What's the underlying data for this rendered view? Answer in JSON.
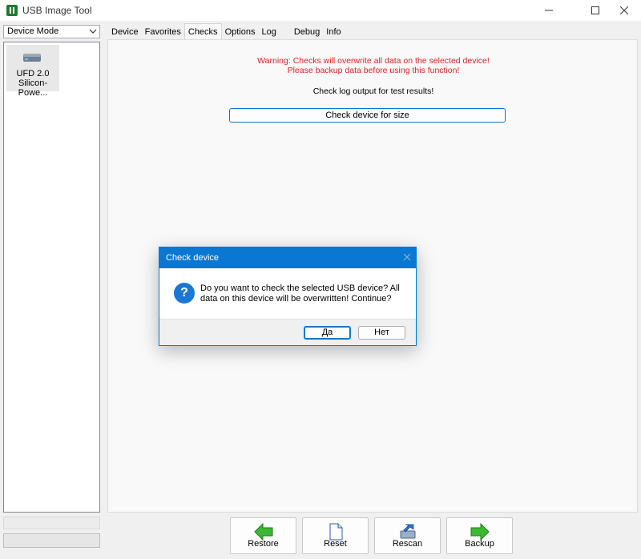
{
  "window": {
    "title": "USB Image Tool"
  },
  "sidebar": {
    "mode_selected": "Device Mode",
    "devices": [
      {
        "line1": "UFD 2.0",
        "line2": "Silicon-Powe..."
      }
    ]
  },
  "tabs": [
    {
      "label": "Device"
    },
    {
      "label": "Favorites"
    },
    {
      "label": "Checks"
    },
    {
      "label": "Options"
    },
    {
      "label": "Log"
    },
    {
      "label": "Debug"
    },
    {
      "label": "Info"
    }
  ],
  "checks": {
    "warning_line1": "Warning: Checks will overwrite all data on the selected device!",
    "warning_line2": "Please backup data before using this function!",
    "info": "Check log output for test results!",
    "check_size_button": "Check device for size"
  },
  "toolbar": {
    "restore": "Restore",
    "reset": "Reset",
    "rescan": "Rescan",
    "backup": "Backup"
  },
  "dialog": {
    "title": "Check device",
    "message": "Do you want to check the selected USB device? All data on this device will be overwritten! Continue?",
    "yes": "Да",
    "no": "Нет"
  },
  "colors": {
    "accent": "#0078d4",
    "warning": "#e02020",
    "arrow_green": "#3cb832"
  }
}
